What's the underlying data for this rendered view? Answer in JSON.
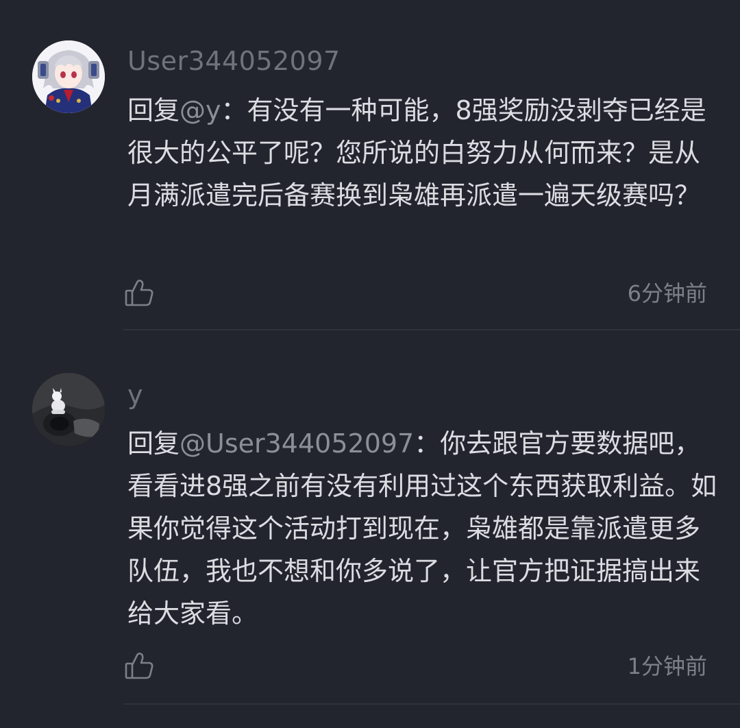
{
  "comments": [
    {
      "username": "User344052097",
      "reply_prefix": "回复",
      "mention": "@y",
      "separator": "：",
      "text": "有没有一种可能，8强奖励没剥夺已经是很大的公平了呢？您所说的白努力从何而来？是从月满派遣完后备赛换到枭雄再派遣一遍天级赛吗？",
      "time": "6分钟前",
      "like_icon": "thumbs-up-icon",
      "avatar": "anime-character-avatar"
    },
    {
      "username": "y",
      "reply_prefix": "回复",
      "mention": "@User344052097",
      "separator": "：",
      "text": "你去跟官方要数据吧，看看进8强之前有没有利用过这个东西获取利益。如果你觉得这个活动打到现在，枭雄都是靠派遣更多队伍，我也不想和你多说了，让官方把证据搞出来给大家看。",
      "time": "1分钟前",
      "like_icon": "thumbs-up-icon",
      "avatar": "dark-photo-avatar"
    }
  ],
  "colors": {
    "background": "#23252e",
    "text": "#dcdde2",
    "username": "#70737c",
    "mention": "#8c8f98",
    "time": "#7d8089",
    "divider": "#30333c"
  }
}
